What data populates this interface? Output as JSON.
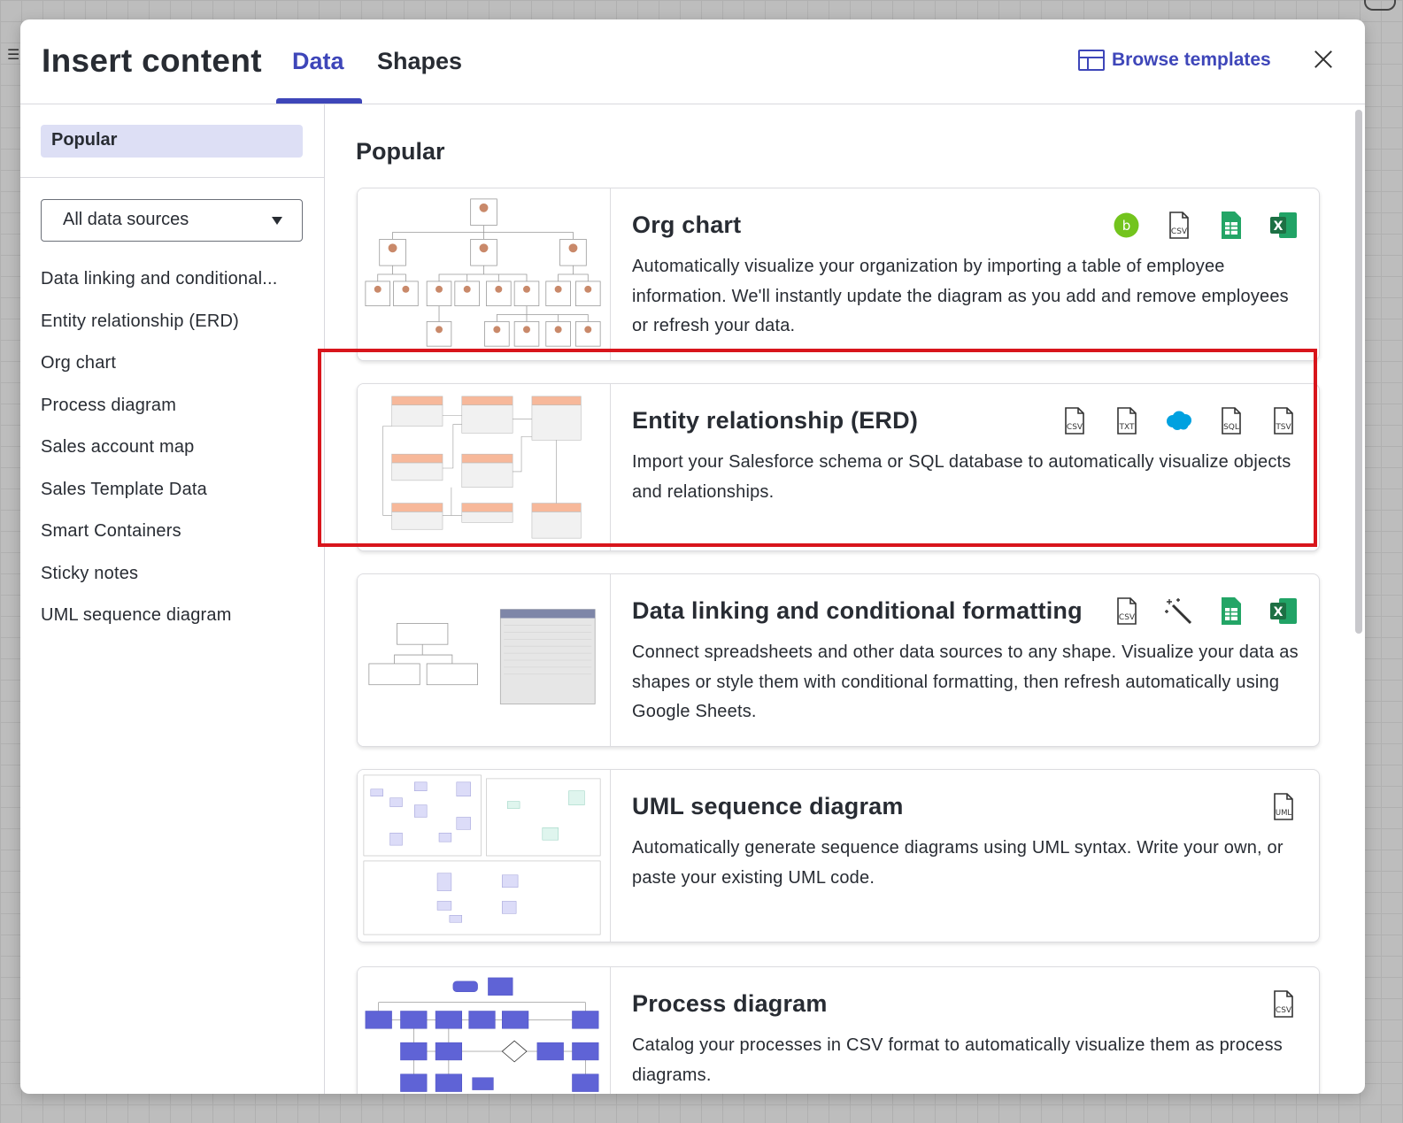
{
  "dialog": {
    "title": "Insert content",
    "tabs": [
      {
        "label": "Data",
        "active": true
      },
      {
        "label": "Shapes",
        "active": false
      }
    ],
    "browse_templates": "Browse templates",
    "close_icon": "close-icon"
  },
  "sidebar": {
    "popular": "Popular",
    "data_source_select": {
      "selected": "All data sources"
    },
    "items": [
      "Data linking and conditional...",
      "Entity relationship (ERD)",
      "Org chart",
      "Process diagram",
      "Sales account map",
      "Sales Template Data",
      "Smart Containers",
      "Sticky notes",
      "UML sequence diagram"
    ]
  },
  "main": {
    "section_title": "Popular",
    "cards": [
      {
        "title": "Org chart",
        "description": "Automatically visualize your organization by importing a table of employee information. We'll instantly update the diagram as you add and remove employees or refresh your data.",
        "icons": [
          "bamboohr-icon",
          "csv-icon",
          "google-sheets-icon",
          "excel-icon"
        ]
      },
      {
        "title": "Entity relationship (ERD)",
        "description": "Import your Salesforce schema or SQL database to automatically visualize objects and relationships.",
        "icons": [
          "csv-icon",
          "txt-icon",
          "salesforce-icon",
          "sql-icon",
          "tsv-icon"
        ],
        "highlighted": true
      },
      {
        "title": "Data linking and conditional formatting",
        "description": "Connect spreadsheets and other data sources to any shape. Visualize your data as shapes or style them with conditional formatting, then refresh automatically using Google Sheets.",
        "icons": [
          "csv-icon",
          "magic-wand-icon",
          "google-sheets-icon",
          "excel-icon"
        ]
      },
      {
        "title": "UML sequence diagram",
        "description": "Automatically generate sequence diagrams using UML syntax. Write your own, or paste your existing UML code.",
        "icons": [
          "uml-icon"
        ]
      },
      {
        "title": "Process diagram",
        "description": "Catalog your processes in CSV format to automatically visualize them as process diagrams.",
        "icons": [
          "csv-icon"
        ]
      }
    ],
    "file_icon_labels": {
      "csv": "CSV",
      "txt": "TXT",
      "sql": "SQL",
      "tsv": "TSV",
      "uml": "UML"
    }
  },
  "colors": {
    "accent": "#3e46b9",
    "highlight": "#d8151c",
    "sidebar_selected": "#dddff5",
    "sheets_green": "#23a566",
    "excel_green": "#1d7044",
    "salesforce_blue": "#00a1e0",
    "bamboo_green": "#73c41d"
  }
}
